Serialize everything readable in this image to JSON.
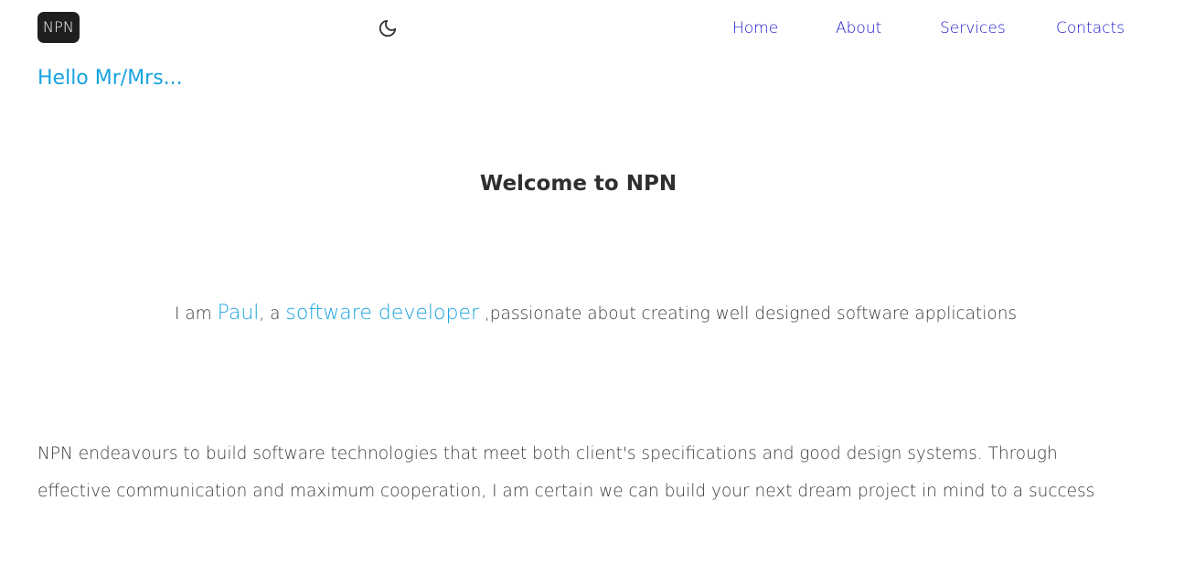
{
  "header": {
    "logo_text": "NPN",
    "theme_toggle_icon": "moon-icon",
    "nav": [
      {
        "label": "Home"
      },
      {
        "label": "About"
      },
      {
        "label": "Services"
      },
      {
        "label": "Contacts"
      }
    ],
    "nav_color": "#1a1acb"
  },
  "main": {
    "greeting": "Hello Mr/Mrs...",
    "title": "Welcome to NPN",
    "intro": {
      "prefix": "I am ",
      "name": "Paul",
      "middle": ", a ",
      "role": "software developer",
      "suffix": " ,passionate about creating well designed software applications"
    },
    "description": "NPN endeavours to build software technologies that meet both client's specifications and good design systems. Through effective communication and maximum cooperation, I am certain we can build your next dream project in mind to a success",
    "accent_color": "#17a3e0"
  }
}
